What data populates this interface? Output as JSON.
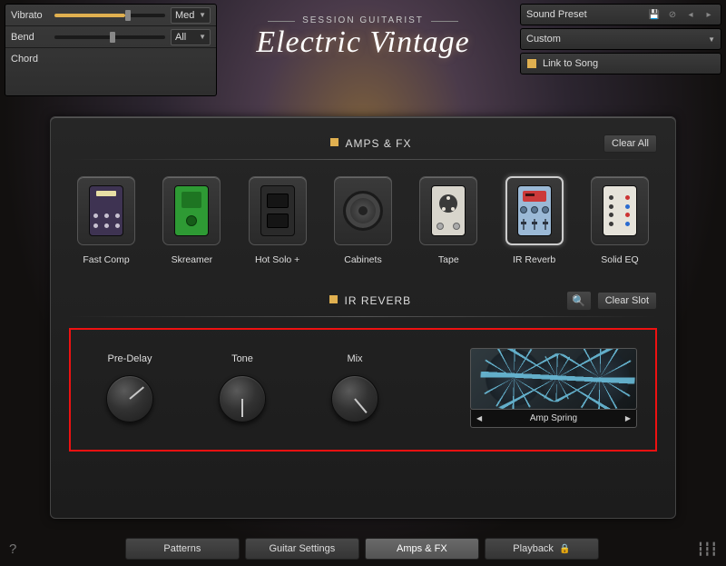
{
  "topLeft": {
    "vibrato": {
      "label": "Vibrato",
      "mode": "Med"
    },
    "bend": {
      "label": "Bend",
      "mode": "All"
    },
    "chord": {
      "label": "Chord"
    }
  },
  "logo": {
    "upper": "SESSION GUITARIST",
    "script": "Electric Vintage"
  },
  "topRight": {
    "presetLabel": "Sound Preset",
    "presetValue": "Custom",
    "linkLabel": "Link to Song"
  },
  "ampsfx": {
    "title": "AMPS & FX",
    "clearAll": "Clear All",
    "slots": [
      {
        "label": "Fast Comp"
      },
      {
        "label": "Skreamer"
      },
      {
        "label": "Hot Solo +"
      },
      {
        "label": "Cabinets"
      },
      {
        "label": "Tape"
      },
      {
        "label": "IR Reverb"
      },
      {
        "label": "Solid EQ"
      }
    ]
  },
  "detail": {
    "title": "IR REVERB",
    "clearSlot": "Clear Slot",
    "knobs": {
      "preDelay": "Pre-Delay",
      "tone": "Tone",
      "mix": "Mix"
    },
    "previewName": "Amp Spring"
  },
  "tabs": {
    "patterns": "Patterns",
    "guitar": "Guitar Settings",
    "ampsfx": "Amps & FX",
    "playback": "Playback"
  }
}
